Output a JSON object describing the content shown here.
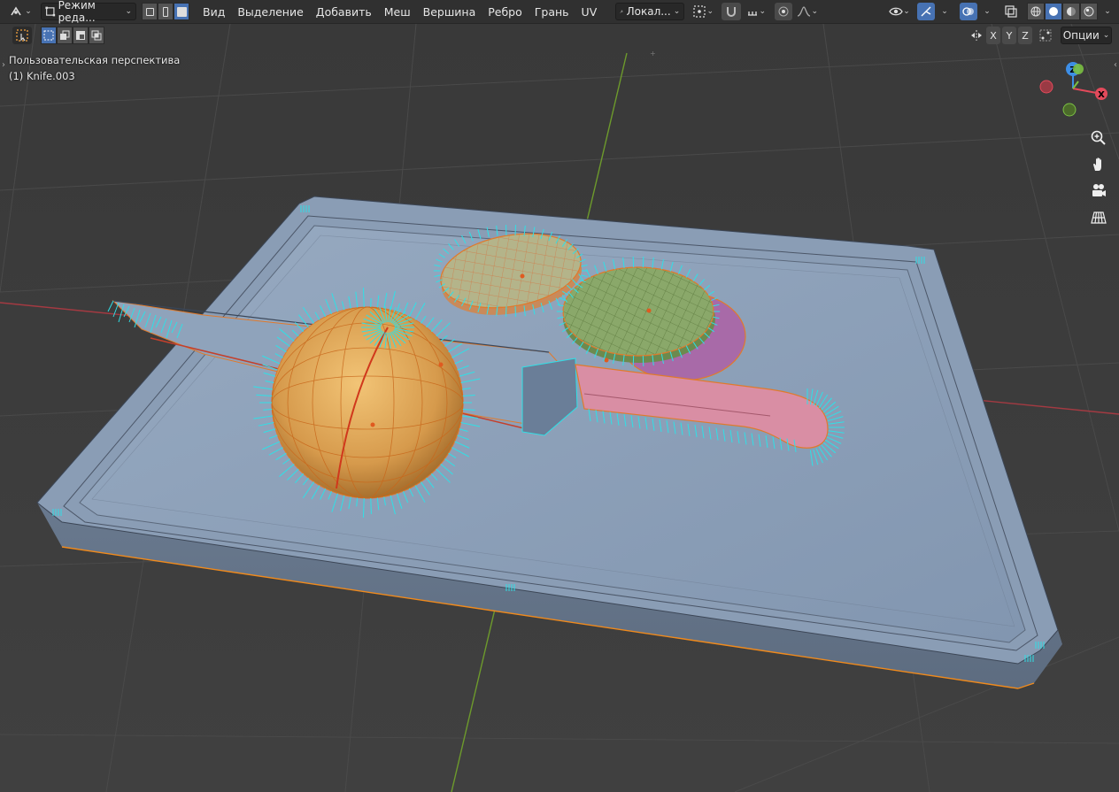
{
  "header": {
    "editor_type_icon": "editor-type-icon",
    "mode_label": "Режим реда...",
    "menus": [
      "Вид",
      "Выделение",
      "Добавить",
      "Меш",
      "Вершина",
      "Ребро",
      "Грань",
      "UV"
    ],
    "transform_orientation": "Локал...",
    "proportional_icon": "proportional-falloff-icon",
    "shading_modes": [
      "wireframe",
      "solid",
      "material",
      "rendered"
    ]
  },
  "toolbar2": {
    "axis_x": "X",
    "axis_y": "Y",
    "axis_z": "Z",
    "options_label": "Опции"
  },
  "viewport": {
    "perspective_label": "Пользовательская перспектива",
    "object_label": "(1) Knife.003"
  },
  "gizmo": {
    "z": "Z",
    "x": "X"
  },
  "colors": {
    "accent": "#4772b3",
    "axis_x": "#e34a5b",
    "axis_y": "#7bc043",
    "axis_z": "#3d8ee6",
    "normals": "#2fe0e6",
    "selection": "#f5891e"
  }
}
